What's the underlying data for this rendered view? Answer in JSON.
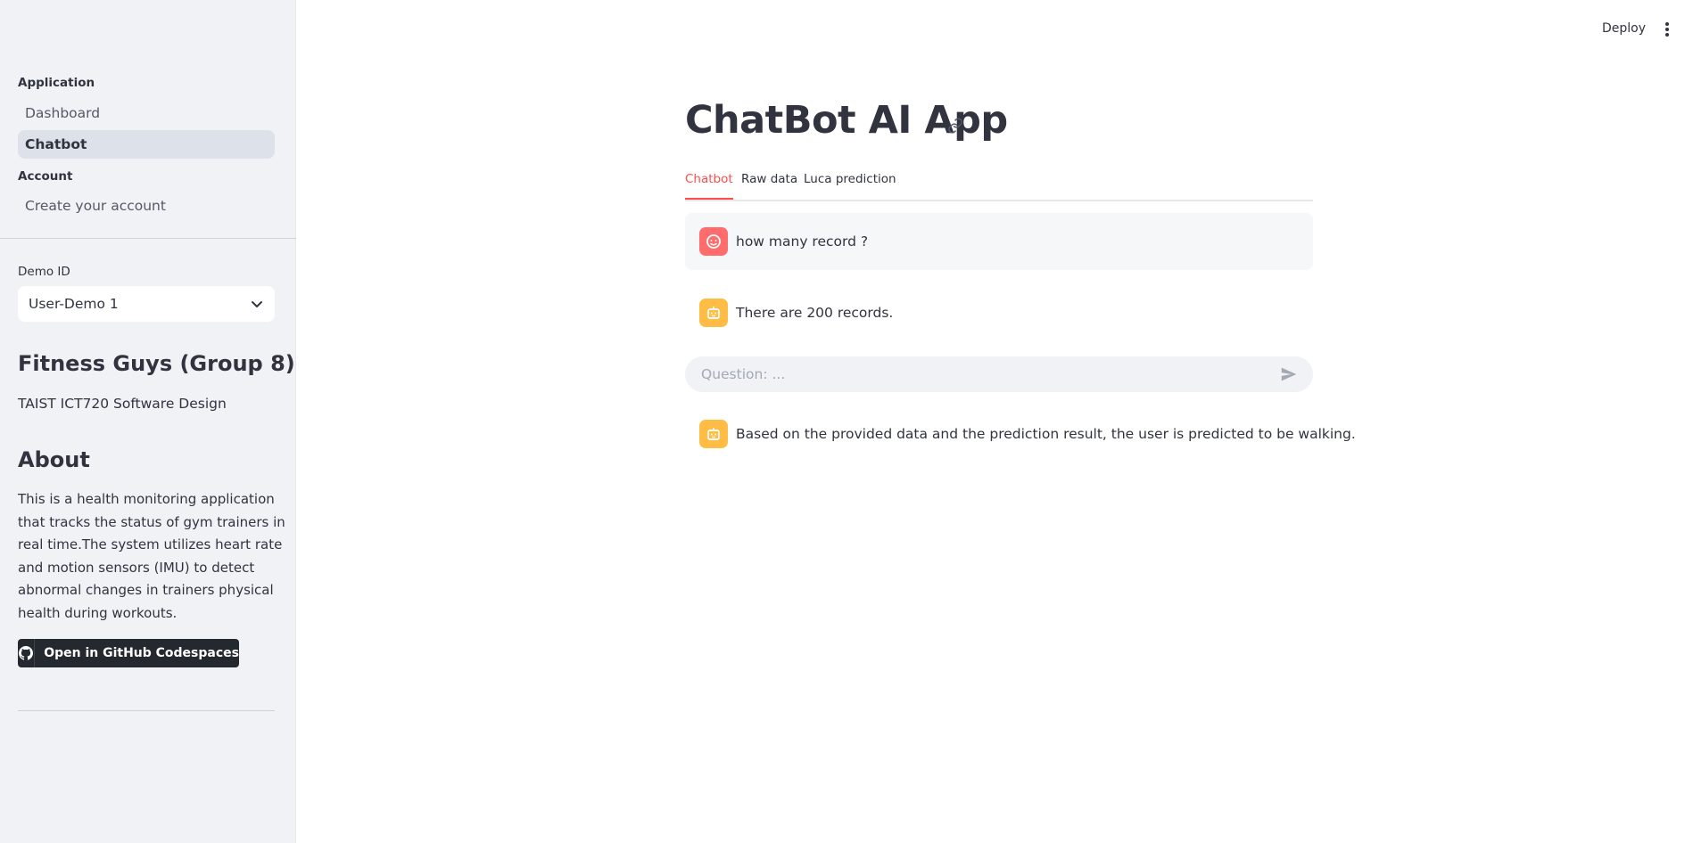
{
  "sidebar": {
    "nav": {
      "section_application": "Application",
      "dashboard": "Dashboard",
      "chatbot": "Chatbot",
      "section_account": "Account",
      "create_account": "Create your account"
    },
    "demo_id_label": "Demo ID",
    "demo_id_value": "User-Demo 1",
    "group_title": "Fitness Guys (Group 8)",
    "course": "TAIST ICT720 Software Design",
    "about_title": "About",
    "about_text": "This is a health monitoring application that tracks the status of gym trainers in real time.The system utilizes heart rate and motion sensors (IMU) to detect abnormal changes in trainers physical health during workouts.",
    "codespaces_button": "Open in GitHub Codespaces"
  },
  "header": {
    "deploy": "Deploy",
    "menu_icon": "more-vertical-icon"
  },
  "main": {
    "title": "ChatBot AI App",
    "tabs": [
      "Chatbot",
      "Raw data",
      "Luca prediction"
    ],
    "active_tab": "Chatbot",
    "messages": [
      {
        "role": "user",
        "text": "how many record ?"
      },
      {
        "role": "assistant",
        "text": "There are 200 records."
      },
      {
        "role": "assistant",
        "text": "Based on the provided data and the prediction result, the user is predicted to be walking."
      }
    ],
    "input_placeholder": "Question: ..."
  },
  "colors": {
    "accent": "#ff4b4b",
    "sidebar_bg": "#f0f2f6",
    "user_avatar": "#ff6c6c",
    "bot_avatar": "#ffbd45"
  }
}
